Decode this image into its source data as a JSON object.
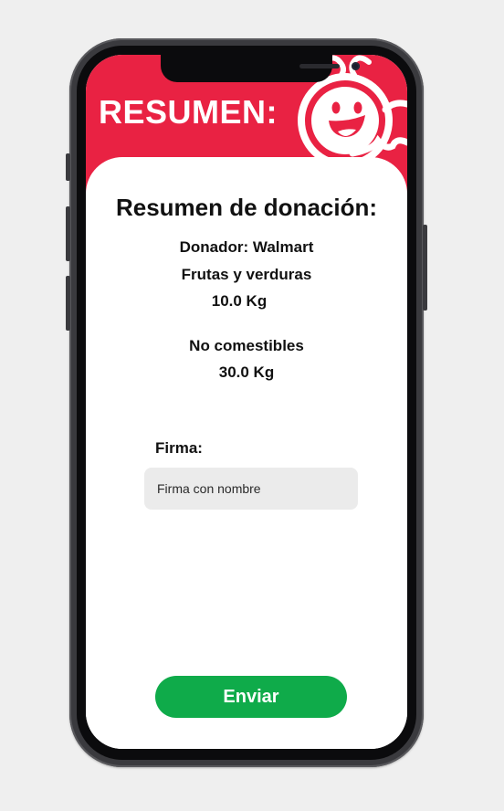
{
  "header": {
    "title": "RESUMEN:",
    "mascot_icon": "smiling-mascot-icon",
    "color": "#e92243"
  },
  "summary": {
    "title": "Resumen de donación:",
    "donor": "Donador: Walmart",
    "items": [
      {
        "category": "Frutas y verduras",
        "weight": "10.0 Kg"
      },
      {
        "category": "No comestibles",
        "weight": "30.0 Kg"
      }
    ]
  },
  "signature": {
    "label": "Firma:",
    "placeholder": "Firma con nombre",
    "value": ""
  },
  "submit": {
    "label": "Enviar",
    "color": "#0fab4a"
  }
}
